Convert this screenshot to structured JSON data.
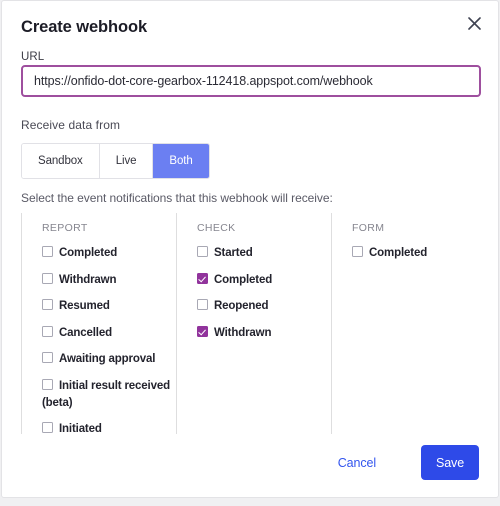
{
  "modal": {
    "title": "Create webhook",
    "close_icon": "close-icon"
  },
  "url_field": {
    "label": "URL",
    "value": "https://onfido-dot-core-gearbox-112418.appspot.com/webhook",
    "placeholder": "https://"
  },
  "receive_data": {
    "label": "Receive data from",
    "options": [
      {
        "label": "Sandbox",
        "active": false
      },
      {
        "label": "Live",
        "active": false
      },
      {
        "label": "Both",
        "active": true
      }
    ],
    "selected": "Both"
  },
  "events": {
    "instruction": "Select the event notifications that this webhook will receive:",
    "columns": [
      {
        "title": "REPORT",
        "items": [
          {
            "label": "Completed",
            "checked": false
          },
          {
            "label": "Withdrawn",
            "checked": false
          },
          {
            "label": "Resumed",
            "checked": false
          },
          {
            "label": "Cancelled",
            "checked": false
          },
          {
            "label": "Awaiting approval",
            "checked": false
          },
          {
            "label": "Initial result received (beta)",
            "checked": false
          },
          {
            "label": "Initiated",
            "checked": false
          }
        ]
      },
      {
        "title": "CHECK",
        "items": [
          {
            "label": "Started",
            "checked": false
          },
          {
            "label": "Completed",
            "checked": true
          },
          {
            "label": "Reopened",
            "checked": false
          },
          {
            "label": "Withdrawn",
            "checked": true
          }
        ]
      },
      {
        "title": "FORM",
        "items": [
          {
            "label": "Completed",
            "checked": false
          }
        ]
      }
    ]
  },
  "footer": {
    "cancel_label": "Cancel",
    "save_label": "Save"
  },
  "colors": {
    "accent_blue": "#2e4ae8",
    "link_blue": "#3355ee",
    "segment_active": "#6b7ff2",
    "checkbox_checked": "#91339c",
    "input_focus_border": "#9e4f9e"
  }
}
